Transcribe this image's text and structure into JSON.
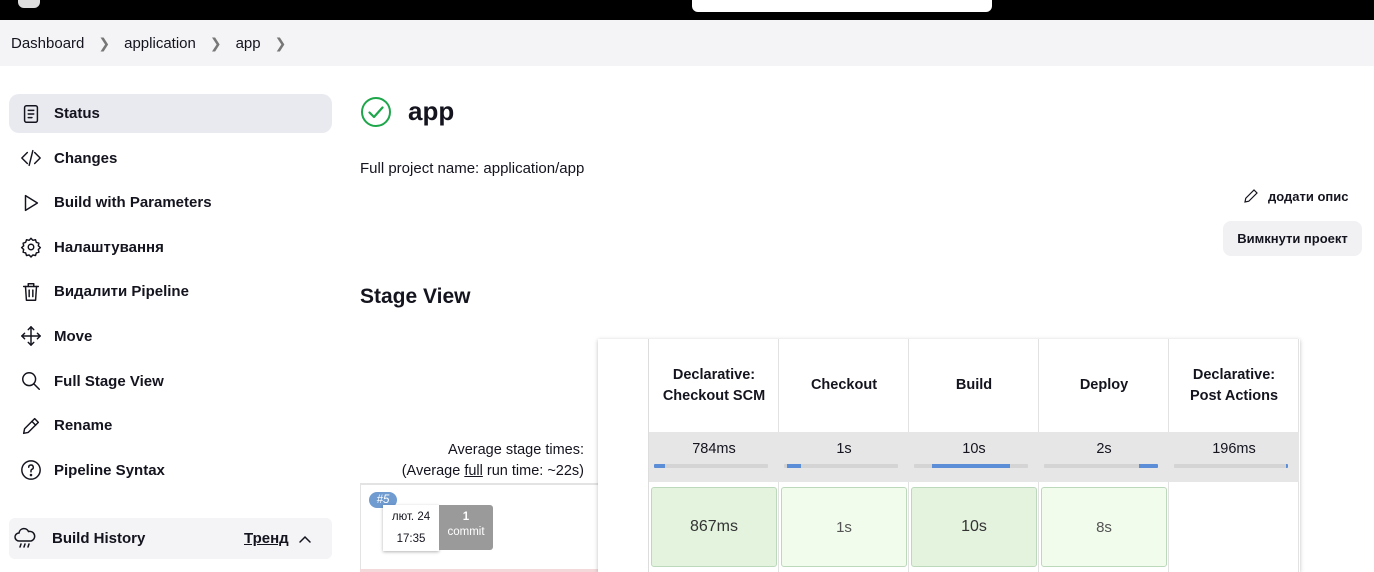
{
  "breadcrumb": [
    "Dashboard",
    "application",
    "app"
  ],
  "sidebar": {
    "items": [
      {
        "label": "Status",
        "icon": "status-doc-icon",
        "active": true
      },
      {
        "label": "Changes",
        "icon": "code-icon"
      },
      {
        "label": "Build with Parameters",
        "icon": "play-icon"
      },
      {
        "label": "Налаштування",
        "icon": "gear-icon"
      },
      {
        "label": "Видалити Pipeline",
        "icon": "trash-icon"
      },
      {
        "label": "Move",
        "icon": "move-icon"
      },
      {
        "label": "Full Stage View",
        "icon": "search-icon"
      },
      {
        "label": "Rename",
        "icon": "pencil-icon"
      },
      {
        "label": "Pipeline Syntax",
        "icon": "help-icon"
      }
    ]
  },
  "build_history": {
    "title": "Build History",
    "trend": "Тренд"
  },
  "header": {
    "title": "app",
    "full_name": "Full project name: application/app",
    "add_description": "додати опис",
    "disable_project": "Вимкнути проект"
  },
  "stage_view": {
    "title": "Stage View",
    "avg_label_1": "Average stage times:",
    "avg_label_2_pre": "(Average ",
    "avg_label_2_link": "full",
    "avg_label_2_post": " run time: ~22s)",
    "stages": [
      {
        "name": "Declarative: Checkout SCM",
        "avg": "784ms",
        "bar_fraction": 0.1,
        "bar_offset": 0.0,
        "cell": "867ms",
        "shade": "dark"
      },
      {
        "name": "Checkout",
        "avg": "1s",
        "bar_fraction": 0.12,
        "bar_offset": 0.03,
        "cell": "1s",
        "shade": "light"
      },
      {
        "name": "Build",
        "avg": "10s",
        "bar_fraction": 0.68,
        "bar_offset": 0.16,
        "cell": "10s",
        "shade": "dark"
      },
      {
        "name": "Deploy",
        "avg": "2s",
        "bar_fraction": 0.17,
        "bar_offset": 0.83,
        "cell": "8s",
        "shade": "light"
      },
      {
        "name": "Declarative: Post Actions",
        "avg": "196ms",
        "bar_fraction": 0.02,
        "bar_offset": 0.98,
        "cell": "",
        "shade": "empty"
      }
    ],
    "build": {
      "number": "#5",
      "date": "лют. 24",
      "time": "17:35",
      "commits_count": "1",
      "commits_label": "commit"
    }
  },
  "colors": {
    "success": "#1ea64b",
    "bar": "#5b8ed6",
    "cell_green": "#e3f3de"
  }
}
